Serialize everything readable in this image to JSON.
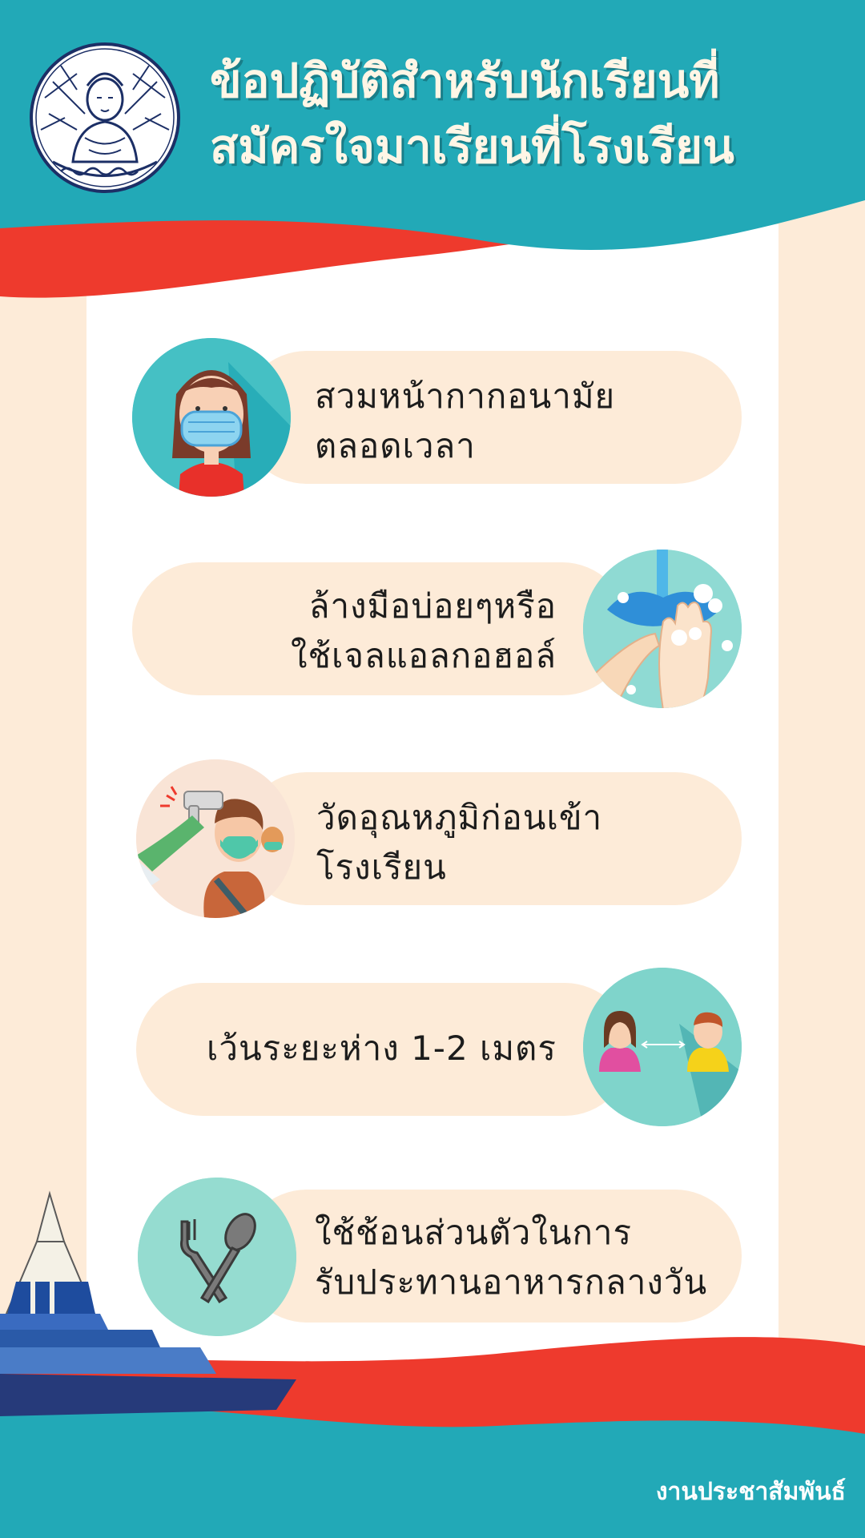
{
  "header": {
    "title_line1": "ข้อปฏิบัติสำหรับนักเรียนที่",
    "title_line2": "สมัครใจมาเรียนที่โรงเรียน"
  },
  "items": [
    {
      "line1": "สวมหน้ากากอนามัย",
      "line2": "ตลอดเวลา",
      "icon": "face-mask-icon"
    },
    {
      "line1": "ล้างมือบ่อยๆหรือ",
      "line2": "ใช้เจลแอลกอฮอล์",
      "icon": "hand-washing-icon"
    },
    {
      "line1": "วัดอุณหภูมิก่อนเข้า",
      "line2": "โรงเรียน",
      "icon": "temperature-check-icon"
    },
    {
      "line1": "เว้นระยะห่าง 1-2 เมตร",
      "icon": "social-distancing-icon"
    },
    {
      "line1": "ใช้ช้อนส่วนตัวในการ",
      "line2": "รับประทานอาหารกลางวัน",
      "icon": "fork-spoon-icon"
    }
  ],
  "footer": {
    "label": "งานประชาสัมพันธ์"
  },
  "colors": {
    "teal": "#22a9b7",
    "red": "#ee3a2d",
    "cream": "#fdebd8",
    "white": "#ffffff",
    "blue": "#2a5aa8"
  }
}
